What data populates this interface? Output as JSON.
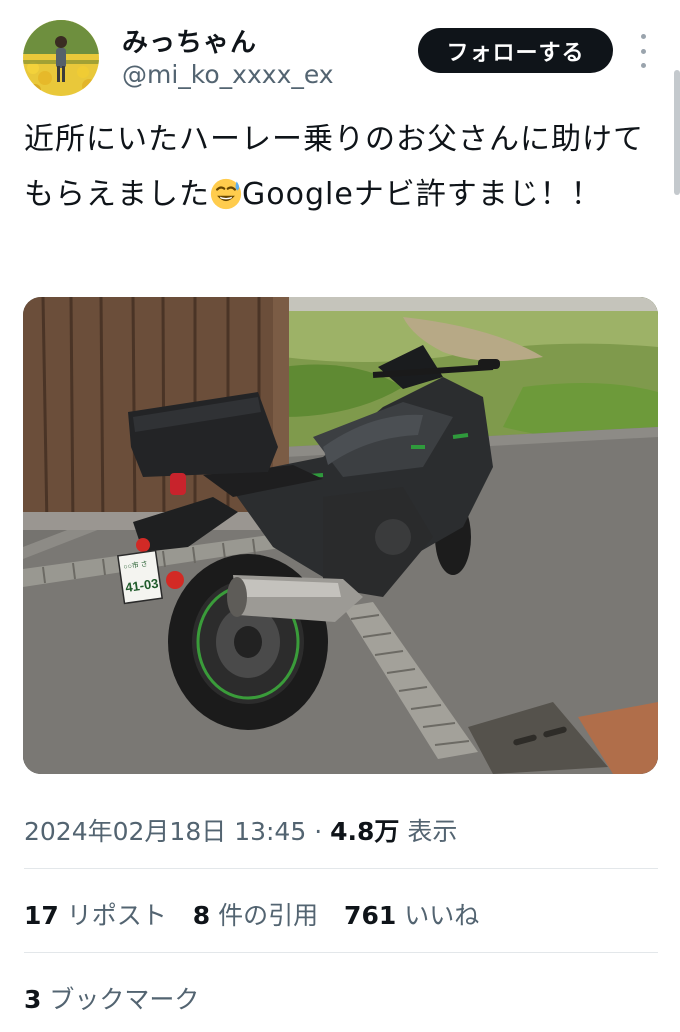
{
  "author": {
    "display_name": "みっちゃん",
    "handle": "@mi_ko_xxxx_ex"
  },
  "header": {
    "follow_label": "フォローする"
  },
  "tweet": {
    "text_before_emoji": "近所にいたハーレー乗りのお父さんに助けてもらえました",
    "emoji": "sweat-smile-emoji",
    "text_after_emoji": "Googleナビ許すまじ！！"
  },
  "photo": {
    "plate_top": "○○市 さ",
    "plate_number": "41-03"
  },
  "meta": {
    "timestamp": "2024年02月18日 13:45",
    "separator": "·",
    "views_count": "4.8万",
    "views_label": "表示"
  },
  "stats": {
    "reposts_count": "17",
    "reposts_label": "リポスト",
    "quotes_count": "8",
    "quotes_label": "件の引用",
    "likes_count": "761",
    "likes_label": "いいね"
  },
  "bookmarks": {
    "count": "3",
    "label": "ブックマーク"
  },
  "icons": [
    "more-vertical-icon",
    "sweat-smile-emoji"
  ]
}
